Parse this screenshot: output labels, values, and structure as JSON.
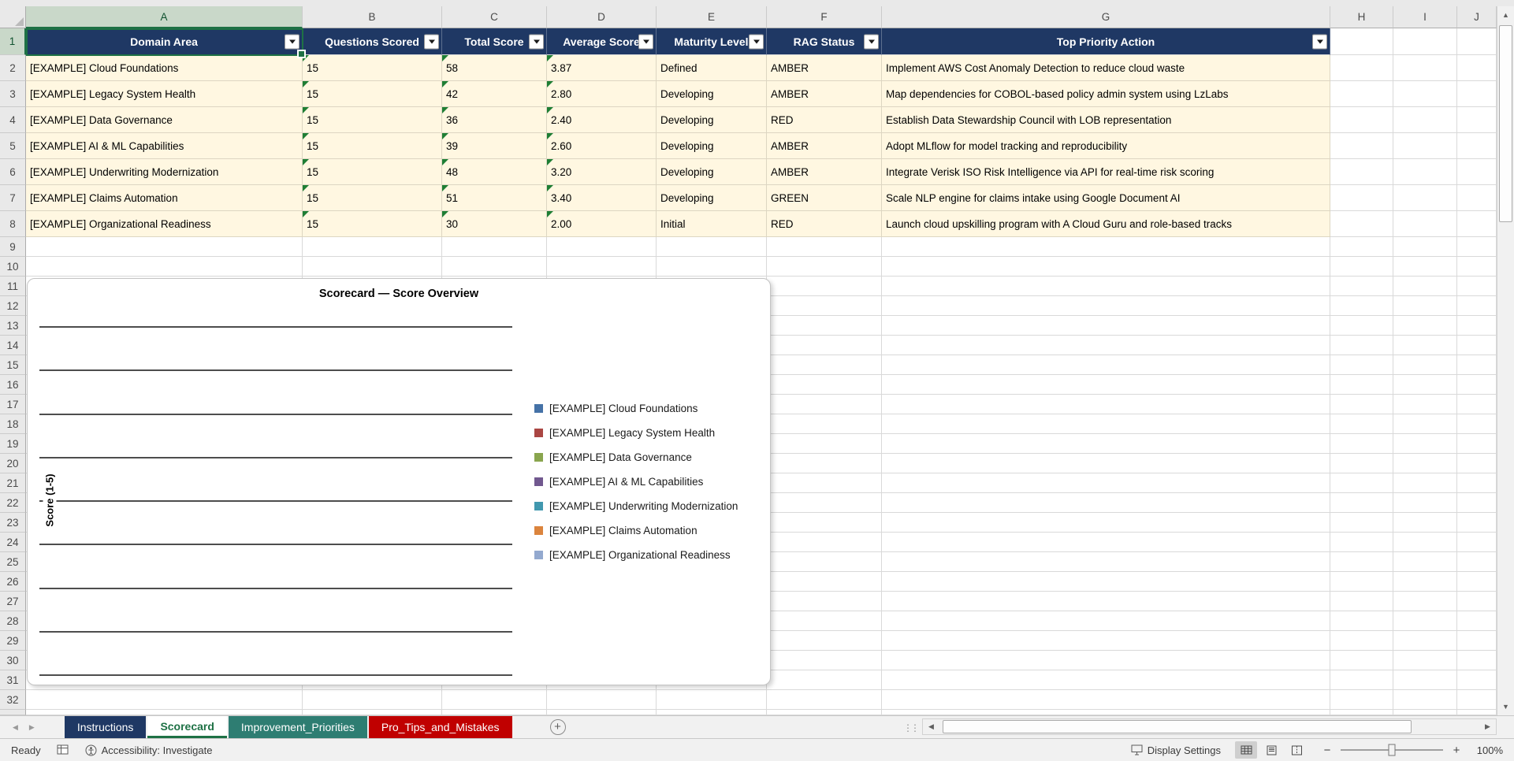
{
  "grid": {
    "column_letters": [
      "A",
      "B",
      "C",
      "D",
      "E",
      "F",
      "G",
      "H",
      "I",
      "J"
    ],
    "row_numbers": [
      "1",
      "2",
      "3",
      "4",
      "5",
      "6",
      "7",
      "8",
      "9",
      "10",
      "11",
      "12",
      "13",
      "14",
      "15",
      "16",
      "17",
      "18",
      "19",
      "20",
      "21",
      "22",
      "23",
      "24",
      "25",
      "26",
      "27",
      "28",
      "29",
      "30",
      "31",
      "32"
    ],
    "selected_cell": "A1"
  },
  "table": {
    "headers": [
      "Domain Area",
      "Questions Scored",
      "Total Score",
      "Average Score",
      "Maturity Level",
      "RAG Status",
      "Top Priority Action"
    ],
    "rows": [
      [
        "[EXAMPLE] Cloud Foundations",
        "15",
        "58",
        "3.87",
        "Defined",
        "AMBER",
        "Implement AWS Cost Anomaly Detection to reduce cloud waste"
      ],
      [
        "[EXAMPLE] Legacy System Health",
        "15",
        "42",
        "2.80",
        "Developing",
        "AMBER",
        "Map dependencies for COBOL-based policy admin system using LzLabs"
      ],
      [
        "[EXAMPLE] Data Governance",
        "15",
        "36",
        "2.40",
        "Developing",
        "RED",
        "Establish Data Stewardship Council with LOB representation"
      ],
      [
        "[EXAMPLE] AI & ML Capabilities",
        "15",
        "39",
        "2.60",
        "Developing",
        "AMBER",
        "Adopt MLflow for model tracking and reproducibility"
      ],
      [
        "[EXAMPLE] Underwriting Modernization",
        "15",
        "48",
        "3.20",
        "Developing",
        "AMBER",
        "Integrate Verisk ISO Risk Intelligence via API for real-time risk scoring"
      ],
      [
        "[EXAMPLE] Claims Automation",
        "15",
        "51",
        "3.40",
        "Developing",
        "GREEN",
        "Scale NLP engine for claims intake using Google Document AI"
      ],
      [
        "[EXAMPLE] Organizational Readiness",
        "15",
        "30",
        "2.00",
        "Initial",
        "RED",
        "Launch cloud upskilling program with A Cloud Guru and role-based tracks"
      ]
    ]
  },
  "chart_data": {
    "type": "bar",
    "title": "Scorecard — Score Overview",
    "ylabel": "Score (1-5)",
    "gridline_count": 9,
    "plot_area_empty": true,
    "legend_position": "right",
    "legend": [
      {
        "label": "[EXAMPLE] Cloud Foundations",
        "color": "#4572A7"
      },
      {
        "label": "[EXAMPLE] Legacy System Health",
        "color": "#AA4643"
      },
      {
        "label": "[EXAMPLE] Data Governance",
        "color": "#89A54E"
      },
      {
        "label": "[EXAMPLE] AI & ML Capabilities",
        "color": "#71588F"
      },
      {
        "label": "[EXAMPLE] Underwriting Modernization",
        "color": "#4198AF"
      },
      {
        "label": "[EXAMPLE] Claims Automation",
        "color": "#DB843D"
      },
      {
        "label": "[EXAMPLE] Organizational Readiness",
        "color": "#93A9CF"
      }
    ]
  },
  "sheet_tabs": {
    "tabs": [
      {
        "label": "Instructions",
        "bg": "#1F3864",
        "fg": "#FFFFFF",
        "active": false
      },
      {
        "label": "Scorecard",
        "bg": "#FFFFFF",
        "fg": "#1E7145",
        "active": true
      },
      {
        "label": "Improvement_Priorities",
        "bg": "#2E7D72",
        "fg": "#FFFFFF",
        "active": false
      },
      {
        "label": "Pro_Tips_and_Mistakes",
        "bg": "#C00000",
        "fg": "#FFFFFF",
        "active": false
      }
    ]
  },
  "status_bar": {
    "ready": "Ready",
    "accessibility": "Accessibility: Investigate",
    "display_settings": "Display Settings",
    "zoom_level": "100%"
  },
  "icons": {
    "tab_scroll_left": "◀",
    "tab_scroll_right": "▶",
    "new_sheet": "+",
    "tabs_handle": "⋮⋮",
    "scroll_left": "◀",
    "scroll_right": "▶",
    "scroll_up": "▲",
    "scroll_down": "▼",
    "zoom_out": "−",
    "zoom_in": "+"
  },
  "colors": {
    "table_header_bg": "#1F3864",
    "table_row_bg": "#FFF7E1",
    "selection_green": "#1E7145"
  }
}
